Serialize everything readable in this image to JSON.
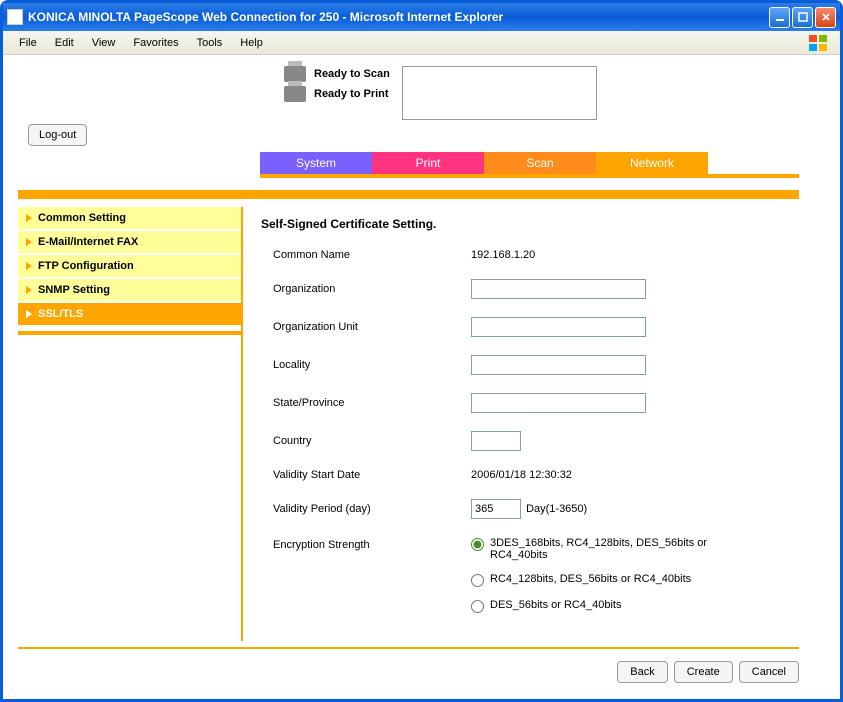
{
  "window": {
    "title": "KONICA MINOLTA PageScope Web Connection for 250 - Microsoft Internet Explorer"
  },
  "menubar": [
    "File",
    "Edit",
    "View",
    "Favorites",
    "Tools",
    "Help"
  ],
  "status": {
    "scan": "Ready to Scan",
    "print": "Ready to Print"
  },
  "logout_label": "Log-out",
  "tabs": {
    "system": "System",
    "print": "Print",
    "scan": "Scan",
    "network": "Network"
  },
  "sidebar": {
    "items": [
      {
        "label": "Common Setting"
      },
      {
        "label": "E-Mail/Internet FAX"
      },
      {
        "label": "FTP Configuration"
      },
      {
        "label": "SNMP Setting"
      },
      {
        "label": "SSL/TLS"
      }
    ]
  },
  "form": {
    "title": "Self-Signed Certificate Setting.",
    "common_name_label": "Common Name",
    "common_name_value": "192.168.1.20",
    "organization_label": "Organization",
    "organization_value": "",
    "org_unit_label": "Organization Unit",
    "org_unit_value": "",
    "locality_label": "Locality",
    "locality_value": "",
    "state_label": "State/Province",
    "state_value": "",
    "country_label": "Country",
    "country_value": "",
    "validity_start_label": "Validity Start Date",
    "validity_start_value": "2006/01/18 12:30:32",
    "validity_period_label": "Validity Period (day)",
    "validity_period_value": "365",
    "validity_period_hint": "Day(1-3650)",
    "encryption_label": "Encryption Strength",
    "encryption_options": [
      "3DES_168bits, RC4_128bits, DES_56bits or RC4_40bits",
      "RC4_128bits, DES_56bits or RC4_40bits",
      "DES_56bits or RC4_40bits"
    ]
  },
  "buttons": {
    "back": "Back",
    "create": "Create",
    "cancel": "Cancel"
  }
}
